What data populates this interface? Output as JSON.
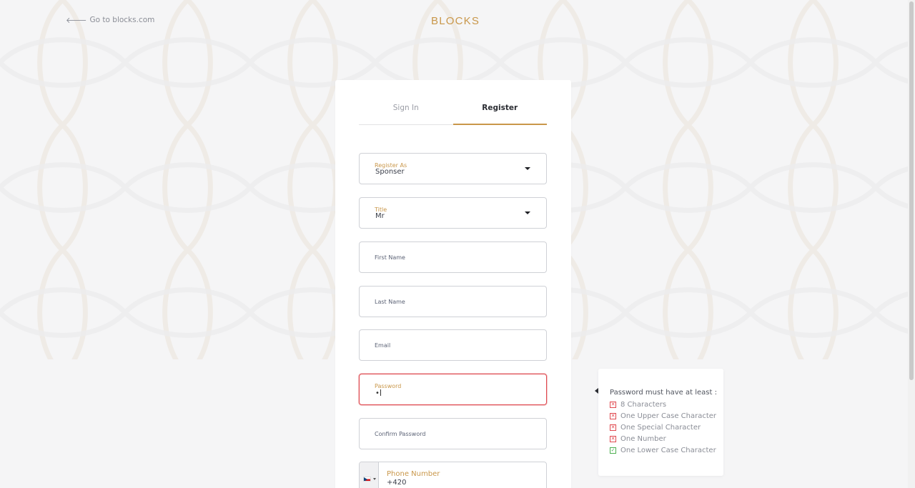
{
  "header": {
    "back_link": "Go to blocks.com",
    "logo": "BLOCKS"
  },
  "tabs": [
    {
      "label": "Sign In",
      "active": false
    },
    {
      "label": "Register",
      "active": true
    }
  ],
  "form": {
    "register_as": {
      "label": "Register As",
      "value": "Sponser"
    },
    "title": {
      "label": "Title",
      "value": "Mr"
    },
    "first_name": {
      "label": "First Name"
    },
    "last_name": {
      "label": "Last Name"
    },
    "email": {
      "label": "Email"
    },
    "password": {
      "label": "Password",
      "value": "•"
    },
    "confirm_password": {
      "label": "Confirm Password"
    },
    "phone": {
      "label": "Phone Number",
      "value": "+420",
      "country_icon": "czech-flag-icon"
    }
  },
  "password_rules": {
    "title": "Password must have at least :",
    "rules": [
      {
        "label": "8 Characters",
        "met": false
      },
      {
        "label": "One Upper Case Character",
        "met": false
      },
      {
        "label": "One Special Character",
        "met": false
      },
      {
        "label": "One Number",
        "met": false
      },
      {
        "label": "One Lower Case Character",
        "met": true
      }
    ]
  },
  "colors": {
    "accent": "#c9974a",
    "error": "#e0484e",
    "success": "#4caf50",
    "background": "#f5f5f6"
  }
}
